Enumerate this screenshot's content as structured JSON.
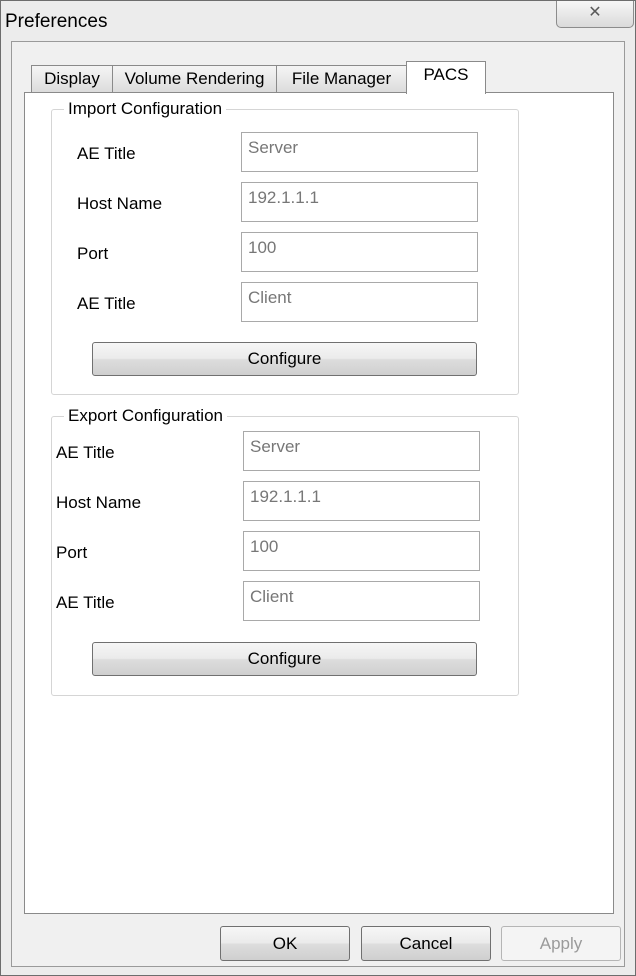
{
  "window": {
    "title": "Preferences",
    "close_glyph": "✕"
  },
  "tabs": [
    {
      "label": "Display"
    },
    {
      "label": "Volume Rendering"
    },
    {
      "label": "File Manager"
    },
    {
      "label": "PACS",
      "active": true
    }
  ],
  "import_config": {
    "title": "Import Configuration",
    "fields": [
      {
        "label": "AE Title",
        "value": "Server"
      },
      {
        "label": "Host Name",
        "value": "192.1.1.1"
      },
      {
        "label": "Port",
        "value": "100"
      },
      {
        "label": "AE Title",
        "value": "Client"
      }
    ],
    "configure_label": "Configure"
  },
  "export_config": {
    "title": "Export Configuration",
    "fields": [
      {
        "label": "AE Title",
        "value": "Server"
      },
      {
        "label": "Host Name",
        "value": "192.1.1.1"
      },
      {
        "label": "Port",
        "value": "100"
      },
      {
        "label": "AE Title",
        "value": "Client"
      }
    ],
    "configure_label": "Configure"
  },
  "footer": {
    "ok_label": "OK",
    "cancel_label": "Cancel",
    "apply_label": "Apply"
  }
}
